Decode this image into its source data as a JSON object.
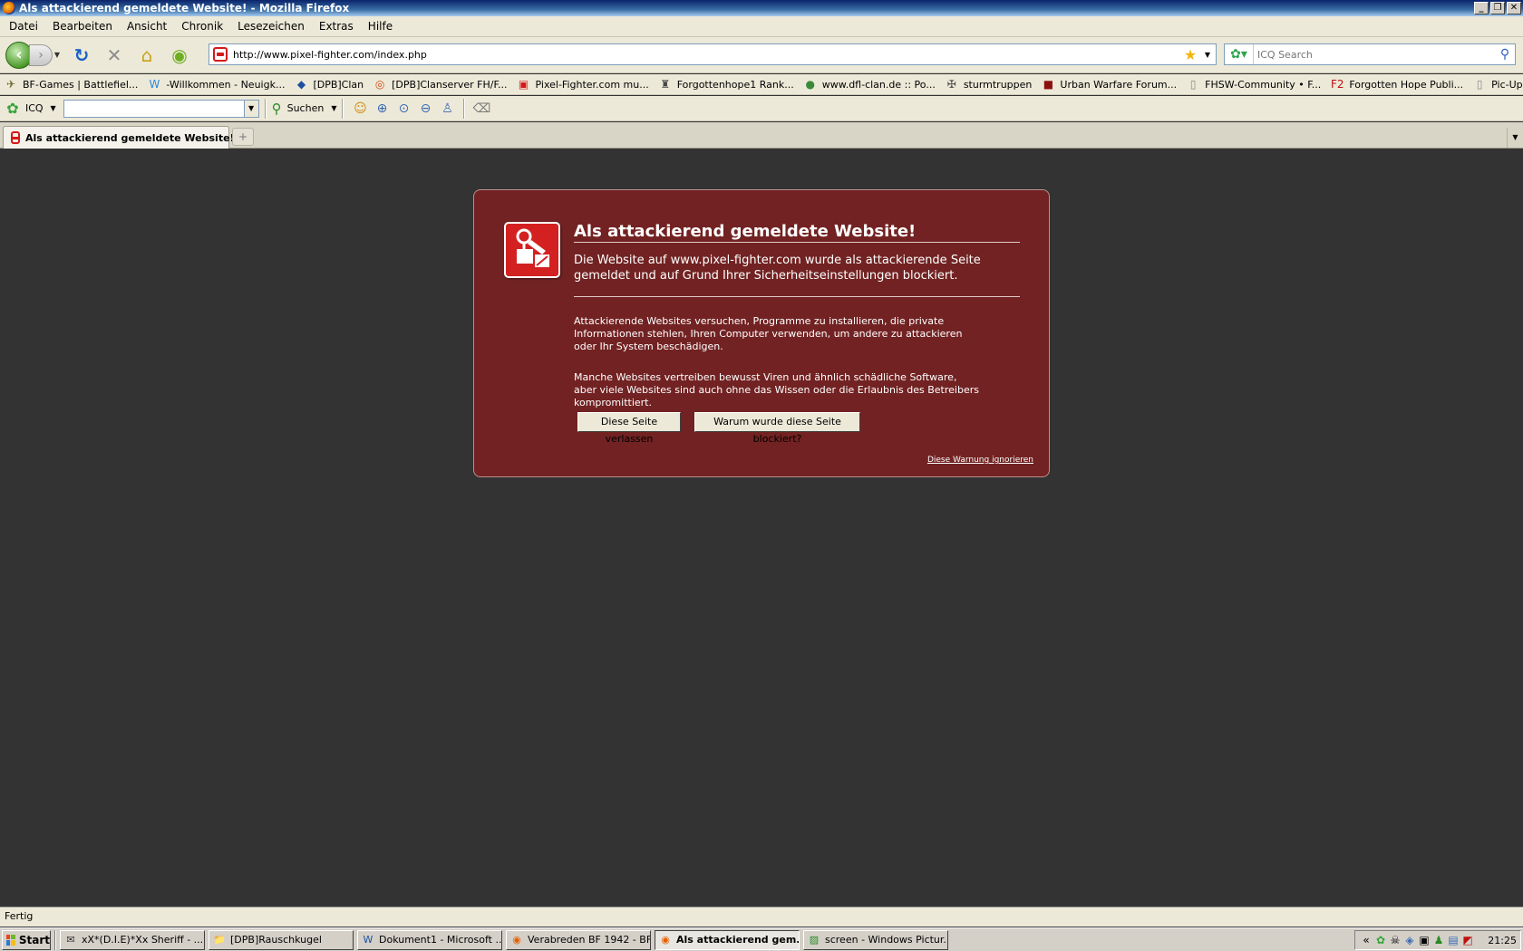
{
  "window": {
    "title": "Als attackierend gemeldete Website! - Mozilla Firefox",
    "buttons": [
      "_",
      "❐",
      "✕"
    ]
  },
  "menu": [
    "Datei",
    "Bearbeiten",
    "Ansicht",
    "Chronik",
    "Lesezeichen",
    "Extras",
    "Hilfe"
  ],
  "navigation": {
    "url": "http://www.pixel-fighter.com/index.php",
    "search_placeholder": "ICQ Search",
    "icons": [
      "back-icon",
      "forward-icon",
      "reload-icon",
      "stop-icon",
      "home-icon",
      "feed-icon",
      "star-icon"
    ]
  },
  "bookmarks": [
    {
      "label": "BF-Games | Battlefiel...",
      "icon": "battlefield-icon",
      "color": "#6b6b2e"
    },
    {
      "label": "-Willkommen - Neuigk...",
      "icon": "w-icon",
      "color": "#2a8ae0"
    },
    {
      "label": "[DPB]Clan",
      "icon": "dpb-icon",
      "color": "#1f4fa0"
    },
    {
      "label": "[DPB]Clanserver FH/F...",
      "icon": "clanserver-icon",
      "color": "#d04a10"
    },
    {
      "label": "Pixel-Fighter.com mu...",
      "icon": "pixel-fighter-icon",
      "color": "#d31919"
    },
    {
      "label": "Forgottenhope1 Rank...",
      "icon": "forgottenhope-icon",
      "color": "#444444"
    },
    {
      "label": "www.dfl-clan.de :: Po...",
      "icon": "dfl-icon",
      "color": "#3a8a3a"
    },
    {
      "label": "sturmtruppen",
      "icon": "sturmtruppen-icon",
      "color": "#555555"
    },
    {
      "label": "Urban Warfare Forum...",
      "icon": "urban-warfare-icon",
      "color": "#8a1010"
    },
    {
      "label": "FHSW-Community • F...",
      "icon": "page-icon",
      "color": "#888888"
    },
    {
      "label": "Forgotten Hope Publi...",
      "icon": "fh2-icon",
      "color": "#c01010"
    },
    {
      "label": "Pic-Upload.de - Koste...",
      "icon": "page-icon",
      "color": "#888888"
    }
  ],
  "icq_toolbar": {
    "label": "ICQ",
    "search_label": "Suchen"
  },
  "tabs": [
    {
      "label": "Als attackierend gemeldete Website!",
      "active": true
    }
  ],
  "error_page": {
    "title": "Als attackierend gemeldete Website!",
    "subtitle": "Die Website auf www.pixel-fighter.com wurde als attackierende Seite gemeldet und auf Grund Ihrer Sicherheitseinstellungen blockiert.",
    "paragraph1": "Attackierende Websites versuchen, Programme zu installieren, die private Informationen stehlen, Ihren Computer verwenden, um andere zu attackieren oder Ihr System beschädigen.",
    "paragraph2": "Manche Websites vertreiben bewusst Viren und ähnlich schädliche Software, aber viele Websites sind auch ohne das Wissen oder die Erlaubnis des Betreibers kompromittiert.",
    "leave_button": "Diese Seite verlassen",
    "why_button": "Warum wurde diese Seite blockiert?",
    "ignore_link": "Diese Warnung ignorieren",
    "background_color": "#722222"
  },
  "status": "Fertig",
  "taskbar": {
    "start_label": "Start",
    "tasks": [
      {
        "label": "xX*(D.I.E)*Xx Sheriff - ...",
        "icon": "chat-icon",
        "active": false
      },
      {
        "label": "[DPB]Rauschkugel",
        "icon": "folder-icon",
        "active": false
      },
      {
        "label": "Dokument1 - Microsoft ...",
        "icon": "word-icon",
        "active": false
      },
      {
        "label": "Verabreden BF 1942 - BF...",
        "icon": "firefox-icon",
        "active": false
      },
      {
        "label": "Als attackierend gem...",
        "icon": "firefox-icon",
        "active": true
      },
      {
        "label": "screen - Windows Pictur...",
        "icon": "picture-icon",
        "active": false
      }
    ],
    "clock": "21:25"
  }
}
